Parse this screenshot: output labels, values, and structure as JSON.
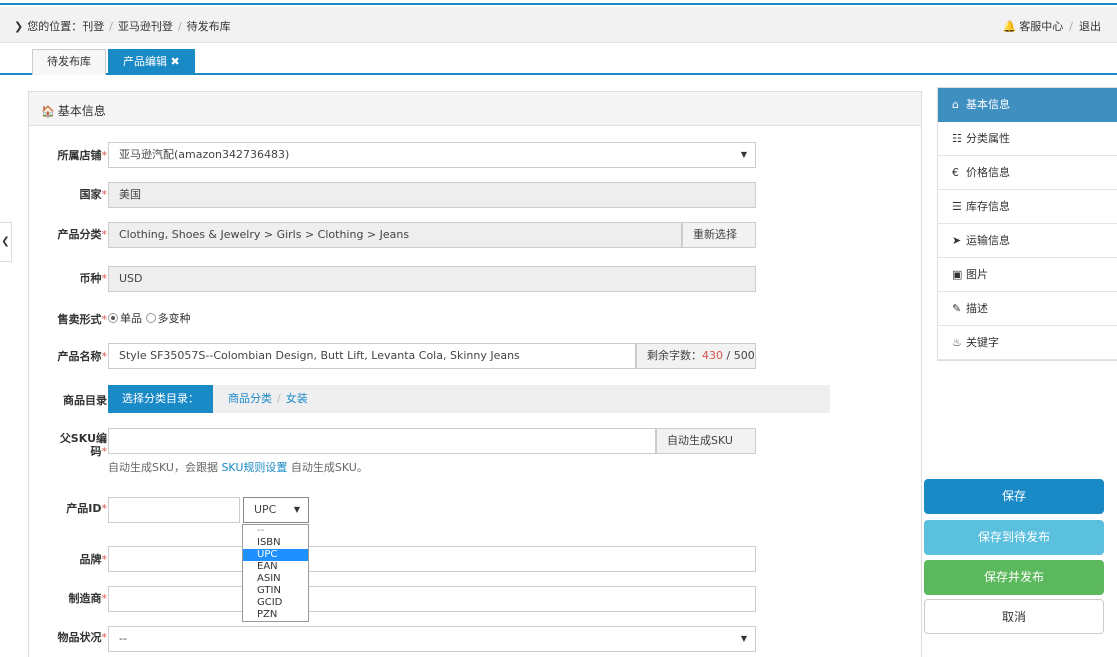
{
  "breadcrumb": {
    "prefix": "您的位置：",
    "items": [
      "刊登",
      "亚马逊刊登",
      "待发布库"
    ]
  },
  "topright": {
    "support": "客服中心",
    "logout": "退出"
  },
  "tabs": [
    {
      "label": "待发布库"
    },
    {
      "label": "产品编辑 ✖"
    }
  ],
  "section": {
    "title": "基本信息"
  },
  "form": {
    "shop": {
      "label": "所属店铺",
      "value": "亚马逊汽配(amazon342736483)"
    },
    "country": {
      "label": "国家",
      "value": "美国"
    },
    "category": {
      "label": "产品分类",
      "value": "Clothing, Shoes & Jewelry > Girls > Clothing > Jeans",
      "button": "重新选择"
    },
    "currency": {
      "label": "币种",
      "value": "USD"
    },
    "sale_type": {
      "label": "售卖形式",
      "opt_single": "单品",
      "opt_variant": "多变种"
    },
    "name": {
      "label": "产品名称",
      "value": "Style SF35057S--Colombian Design, Butt Lift, Levanta Cola, Skinny Jeans",
      "counter_label": "剩余字数：",
      "remaining": "430",
      "total": "/ 500"
    },
    "catalog": {
      "label": "商品目录",
      "button": "选择分类目录：",
      "path1": "商品分类",
      "path2": "女装"
    },
    "parent_sku": {
      "label1": "父SKU编",
      "label2": "码",
      "button": "自动生成SKU",
      "hint_pre": "自动生成SKU，会跟据",
      "hint_link": "SKU规则设置",
      "hint_post": "自动生成SKU。"
    },
    "product_id": {
      "label": "产品ID",
      "type_value": "UPC"
    },
    "brand": {
      "label": "品牌"
    },
    "manufacturer": {
      "label": "制造商"
    },
    "condition": {
      "label": "物品状况",
      "value": "--"
    }
  },
  "id_type_options": [
    "--",
    "ISBN",
    "UPC",
    "EAN",
    "ASIN",
    "GTIN",
    "GCID",
    "PZN"
  ],
  "sidenav": [
    {
      "label": "基本信息",
      "icon": "home-icon"
    },
    {
      "label": "分类属性",
      "icon": "grid-icon"
    },
    {
      "label": "价格信息",
      "icon": "euro-icon"
    },
    {
      "label": "库存信息",
      "icon": "list-icon"
    },
    {
      "label": "运输信息",
      "icon": "send-icon"
    },
    {
      "label": "图片",
      "icon": "picture-icon"
    },
    {
      "label": "描述",
      "icon": "pencil-icon"
    },
    {
      "label": "关键字",
      "icon": "fire-icon"
    }
  ],
  "actions": {
    "save": "保存",
    "save_draft": "保存到待发布",
    "save_publish": "保存并发布",
    "cancel": "取消"
  },
  "colors": {
    "primary": "#1a8ac7",
    "info": "#5bc0de",
    "success": "#5cb85c",
    "required": "#d9534f",
    "counter": "#d9534f"
  }
}
